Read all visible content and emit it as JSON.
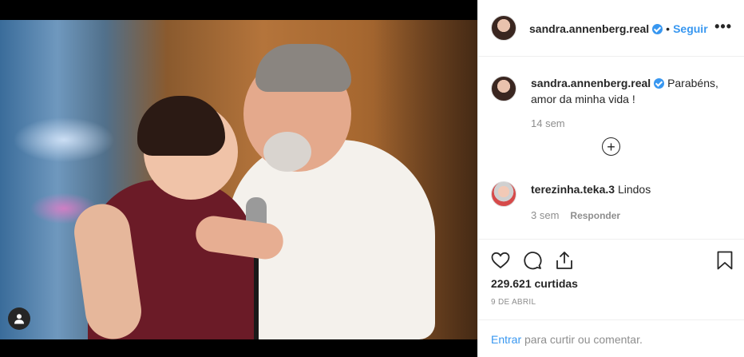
{
  "post": {
    "username": "sandra.annenberg.real",
    "follow_label": "Seguir",
    "separator": "•",
    "more_label": "•••"
  },
  "caption": {
    "username": "sandra.annenberg.real",
    "text": "Parabéns, amor da minha vida !",
    "time": "14 sem",
    "load_more_icon": "plus-circle-icon"
  },
  "comments": [
    {
      "username": "terezinha.teka.3",
      "text": "Lindos",
      "time": "3 sem",
      "reply_label": "Responder"
    }
  ],
  "actions": {
    "icons": [
      "heart-icon",
      "comment-icon",
      "share-icon",
      "bookmark-icon"
    ],
    "likes": "229.621 curtidas",
    "date": "9 DE ABRIL"
  },
  "login": {
    "link_label": "Entrar",
    "text": " para curtir ou comentar."
  },
  "colors": {
    "link": "#3897f0",
    "muted": "#8e8e8e",
    "text": "#262626"
  }
}
